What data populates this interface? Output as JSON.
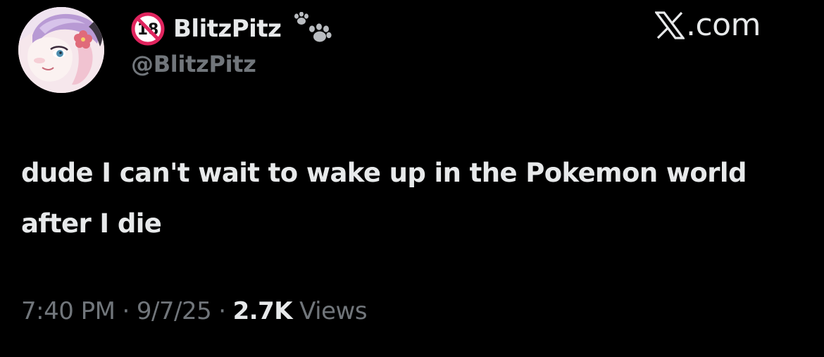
{
  "author": {
    "display_name": "BlitzPitz",
    "handle": "@BlitzPitz",
    "badge_icon": "adult-18-plus-icon",
    "name_emoji_icon": "paw-prints-icon",
    "avatar_icon": "avatar-anime-character"
  },
  "brand": {
    "logo_icon": "x-logo-icon",
    "text": ".com"
  },
  "tweet": {
    "text": "dude I can't wait to wake up in the Pokemon world after I die"
  },
  "meta": {
    "time": "7:40 PM",
    "separator": "·",
    "date": "9/7/25",
    "views_count": "2.7K",
    "views_label": "Views"
  },
  "colors": {
    "background": "#000000",
    "primary_text": "#e7e9ea",
    "secondary_text": "#71767b",
    "badge_red": "#e0245e"
  }
}
